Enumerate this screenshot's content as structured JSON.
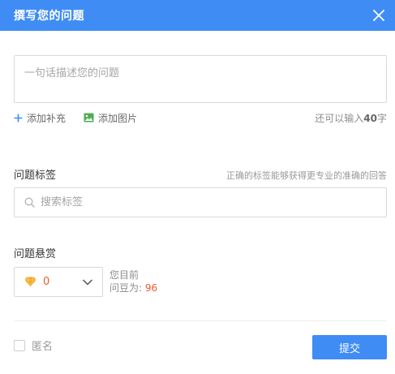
{
  "dialog": {
    "title": "撰写您的问题",
    "close_icon": "close-icon"
  },
  "question": {
    "placeholder": "一句话描述您的问题",
    "value": ""
  },
  "tools": {
    "add_supplement_label": "添加补充",
    "add_supplement_icon": "plus-icon",
    "add_image_label": "添加图片",
    "add_image_icon": "image-icon",
    "limit_prefix": "还可以输入",
    "limit_count": "40",
    "limit_suffix": "字"
  },
  "tags": {
    "label": "问题标签",
    "hint": "正确的标签能够获得更专业的准确的回答",
    "search_placeholder": "搜索标签",
    "search_icon": "search-icon"
  },
  "bounty": {
    "label": "问题悬赏",
    "selected_value": "0",
    "gem_icon": "diamond-icon",
    "chevron_icon": "chevron-down-icon",
    "balance_line1": "您目前",
    "balance_line2_prefix": "问豆为: ",
    "balance_amount": "96"
  },
  "footer": {
    "anonymous_label": "匿名",
    "anonymous_checked": false,
    "submit_label": "提交"
  },
  "colors": {
    "accent": "#3f8cf5",
    "highlight": "#f05a28",
    "image_icon": "#4caf50"
  }
}
